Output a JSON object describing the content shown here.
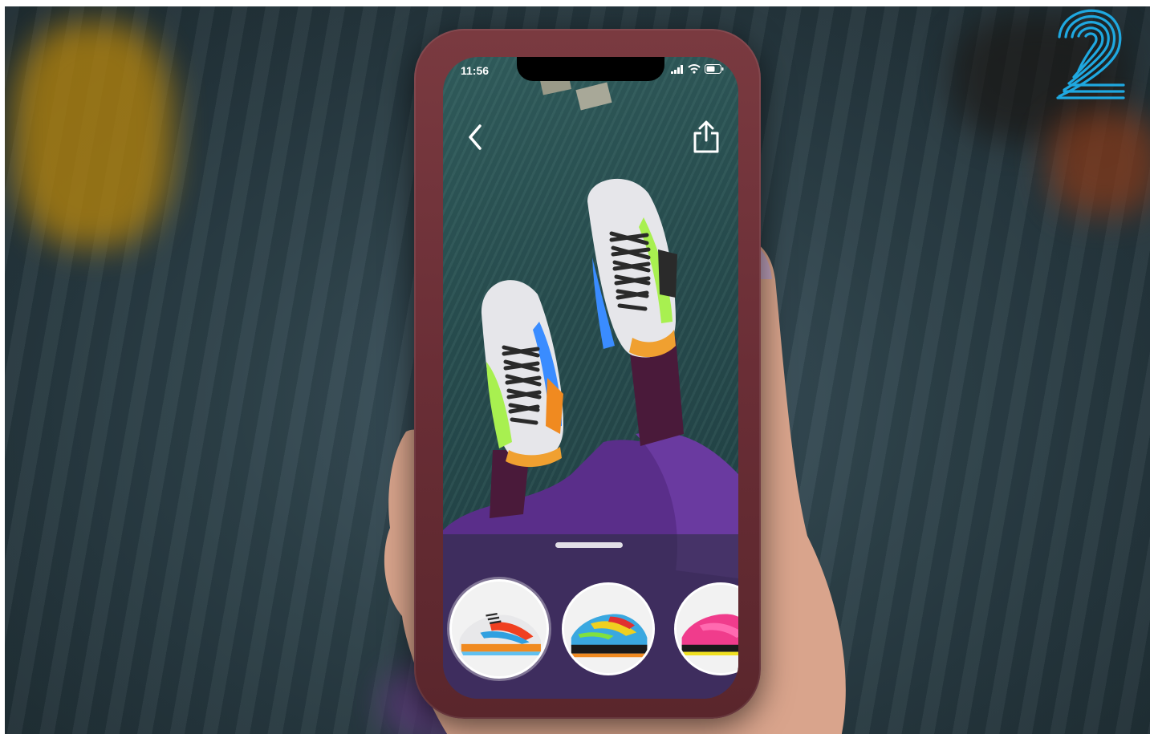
{
  "status_bar": {
    "time": "11:56"
  },
  "icons": {
    "back": "chevron-left-icon",
    "share": "share-icon",
    "signal": "signal-icon",
    "wifi": "wifi-icon",
    "battery": "battery-icon",
    "logo": "fingerprint-2-logo"
  },
  "colors": {
    "phone_case": "#6a2e36",
    "screen_bg": "#264a4c",
    "tray_bg": "#282e3a",
    "logo_accent": "#1fa8e0",
    "leggings": "#4a1a3a",
    "pants": "#5a2e8a"
  },
  "product_carousel": {
    "items": [
      {
        "name": "sneaker-style-1",
        "selected": true
      },
      {
        "name": "sneaker-style-2",
        "selected": false
      },
      {
        "name": "sneaker-style-3",
        "selected": false
      }
    ]
  }
}
